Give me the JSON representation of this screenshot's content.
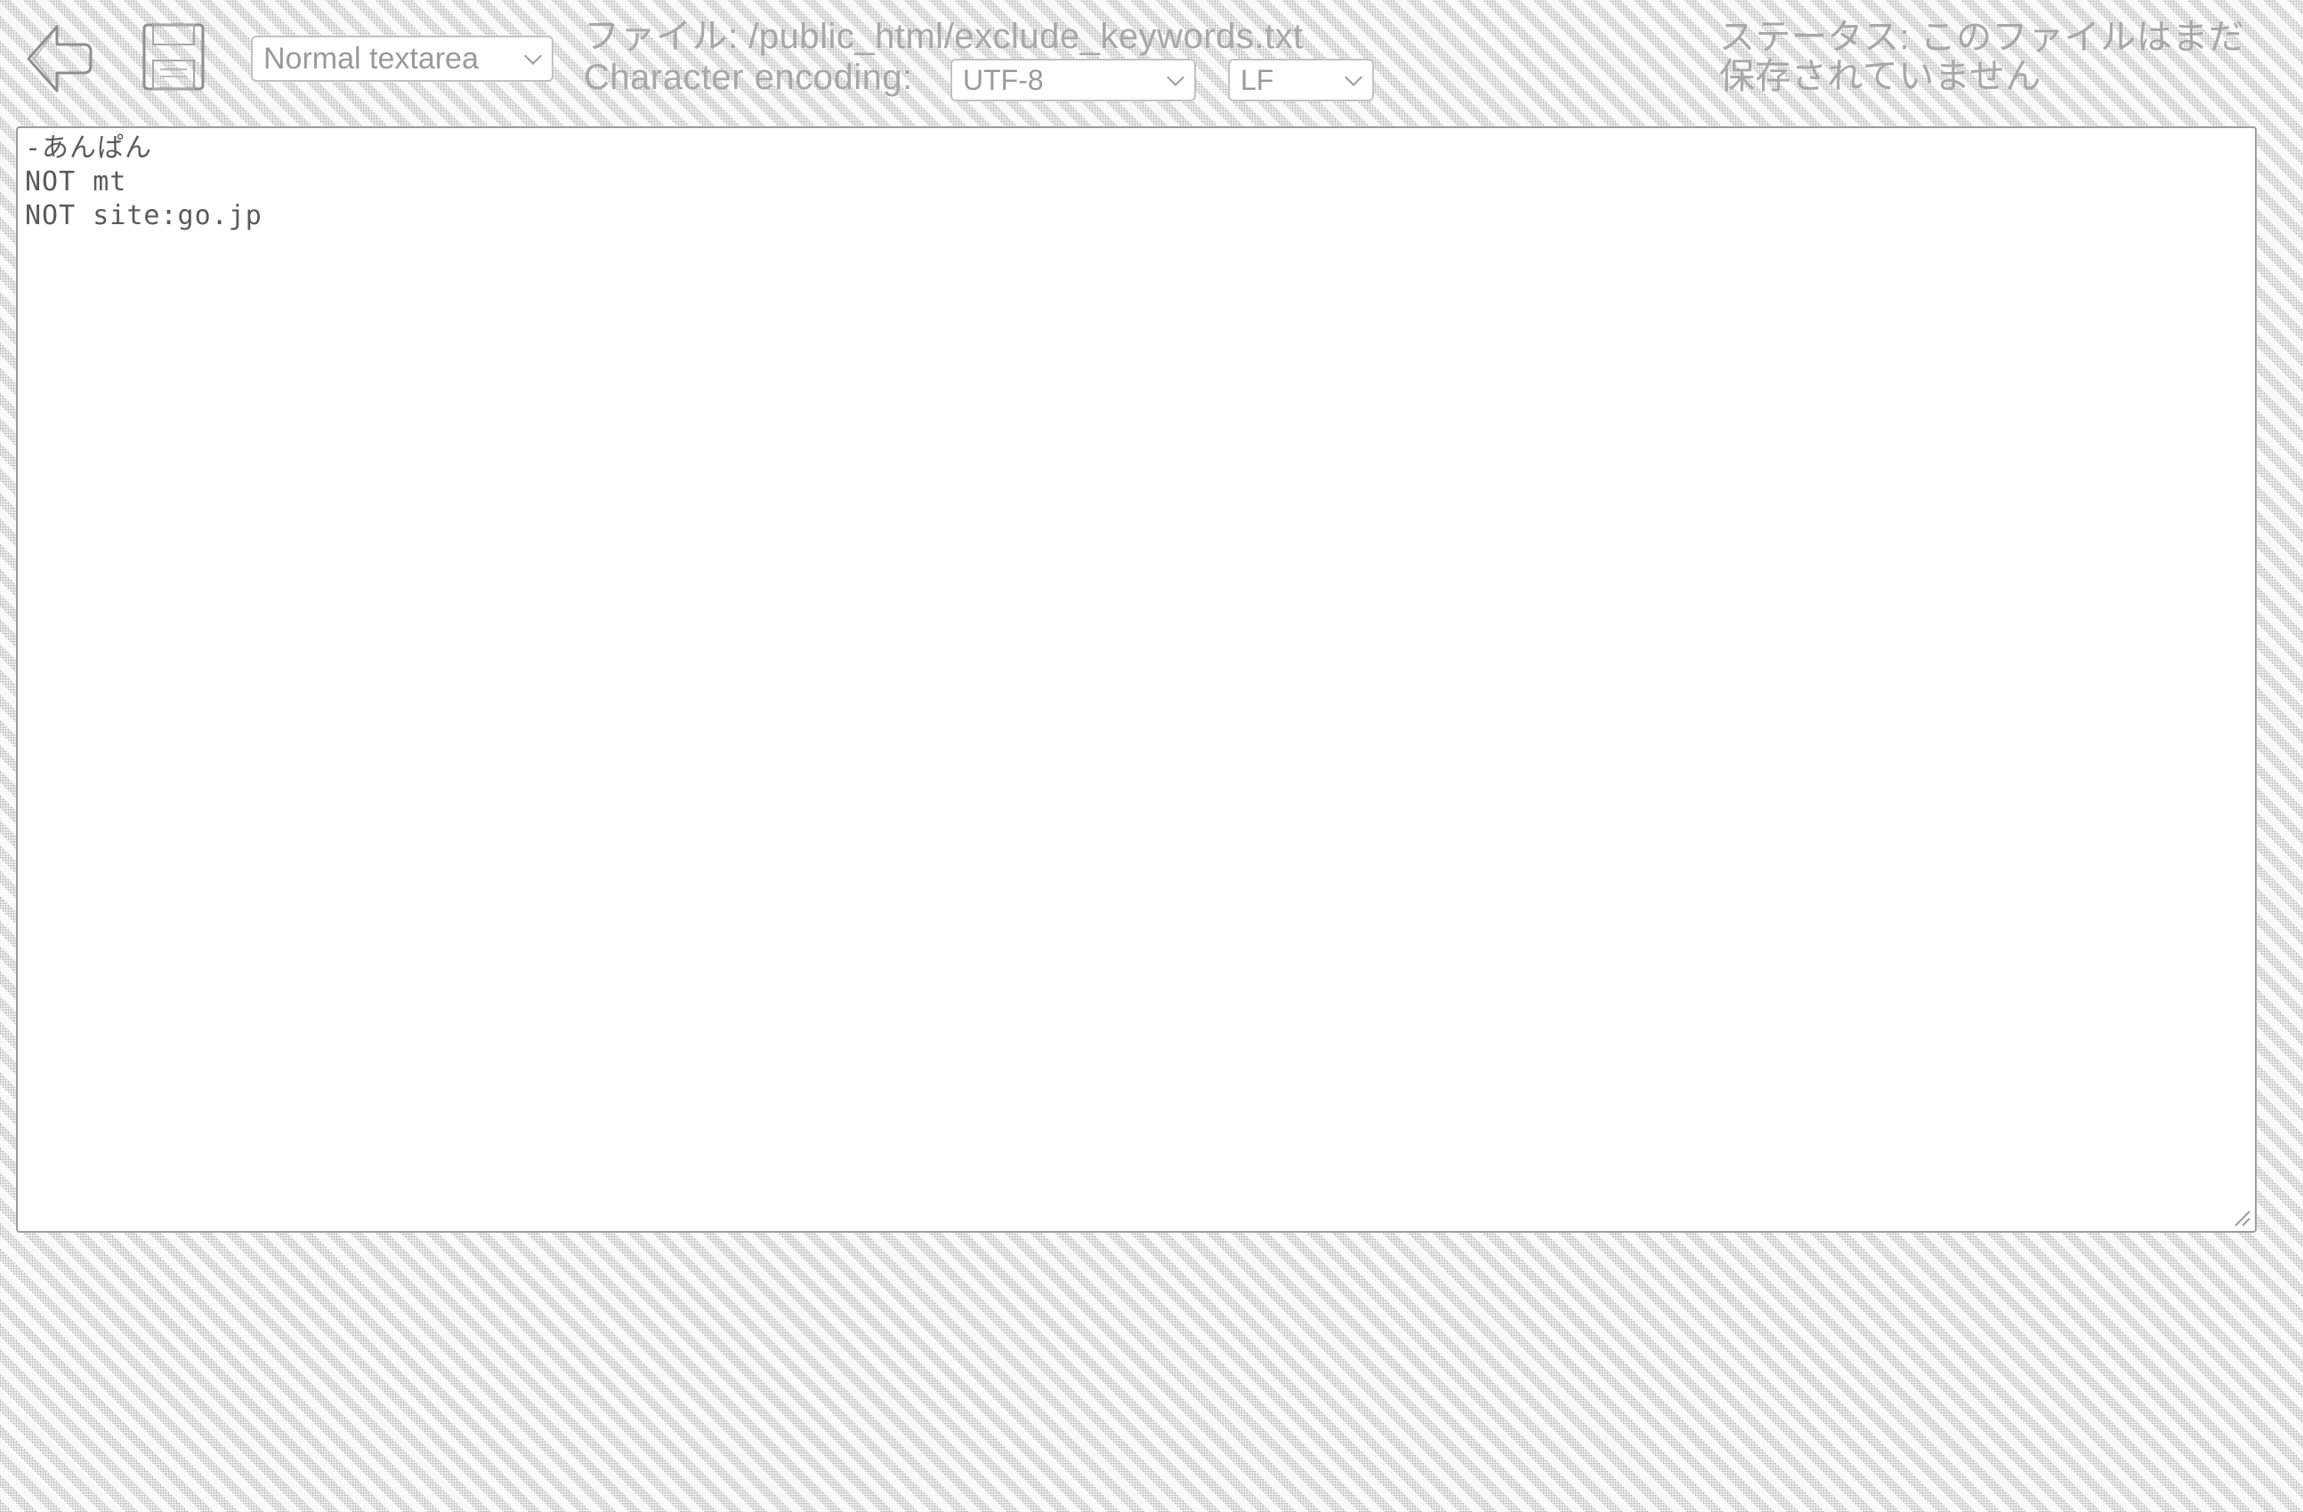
{
  "toolbar": {
    "back_icon": "back-arrow-icon",
    "save_icon": "floppy-disk-icon",
    "editor_mode": {
      "selected": "Normal textarea"
    },
    "file_label": "ファイル:",
    "file_path": "/public_html/exclude_keywords.txt",
    "encoding_label": "Character encoding:",
    "encoding": {
      "selected": "UTF-8"
    },
    "line_ending": {
      "selected": "LF"
    },
    "status_text": "ステータス: このファイルはまだ保存されていません"
  },
  "editor": {
    "lines": [
      "-あんぱん",
      "NOT mt",
      "NOT site:go.jp"
    ]
  },
  "colors": {
    "text_muted": "#a8a8a8",
    "editor_background": "#ffffff",
    "editor_border": "#9c9c9c"
  }
}
